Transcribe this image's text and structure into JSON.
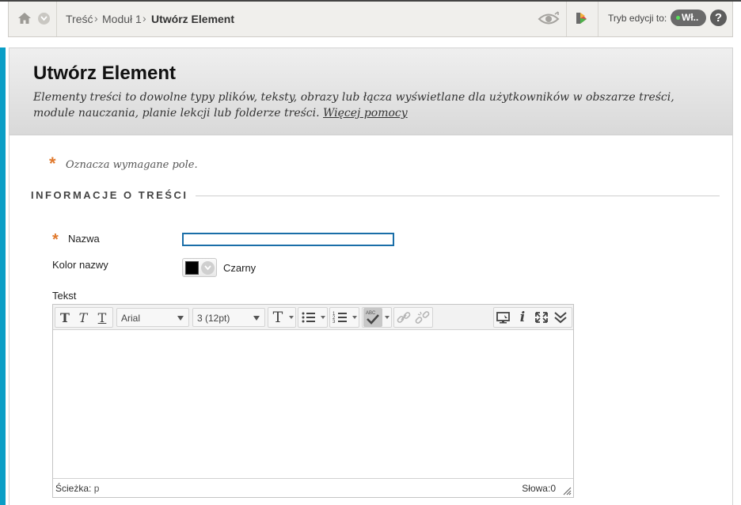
{
  "topbar": {
    "breadcrumbs": [
      "Treść",
      "Moduł 1"
    ],
    "current": "Utwórz Element",
    "separator": "›",
    "edit_mode_label": "Tryb edycji to:",
    "edit_mode_value": "Wł..",
    "help": "?"
  },
  "header": {
    "title": "Utwórz Element",
    "description": "Elementy treści to dowolne typy plików, tekst­y, obrazy lub łącza wyświetlane dla użytkowników w obszarze treści, module nauczania, planie lekcji lub folderze treści.",
    "more_help": "Więcej pomocy"
  },
  "form": {
    "required_star": "*",
    "required_note": "Oznacza wymagane pole.",
    "section_title": "INFORMACJE O TREŚCI",
    "name_label": "Nazwa",
    "name_value": "",
    "color_label": "Kolor nazwy",
    "color_value": "Czarny",
    "color_hex": "#000000",
    "text_label": "Tekst"
  },
  "editor": {
    "font_family": "Arial",
    "font_size": "3 (12pt)",
    "bold": "T",
    "italic": "T",
    "underline": "T",
    "format": "T",
    "path_label": "Ścieżka:",
    "path_value": "p",
    "words_label": "Słowa:0"
  },
  "colors": {
    "accent_blue": "#0a9ec6",
    "required_orange": "#e0792d",
    "input_focus": "#1a6ea8"
  }
}
